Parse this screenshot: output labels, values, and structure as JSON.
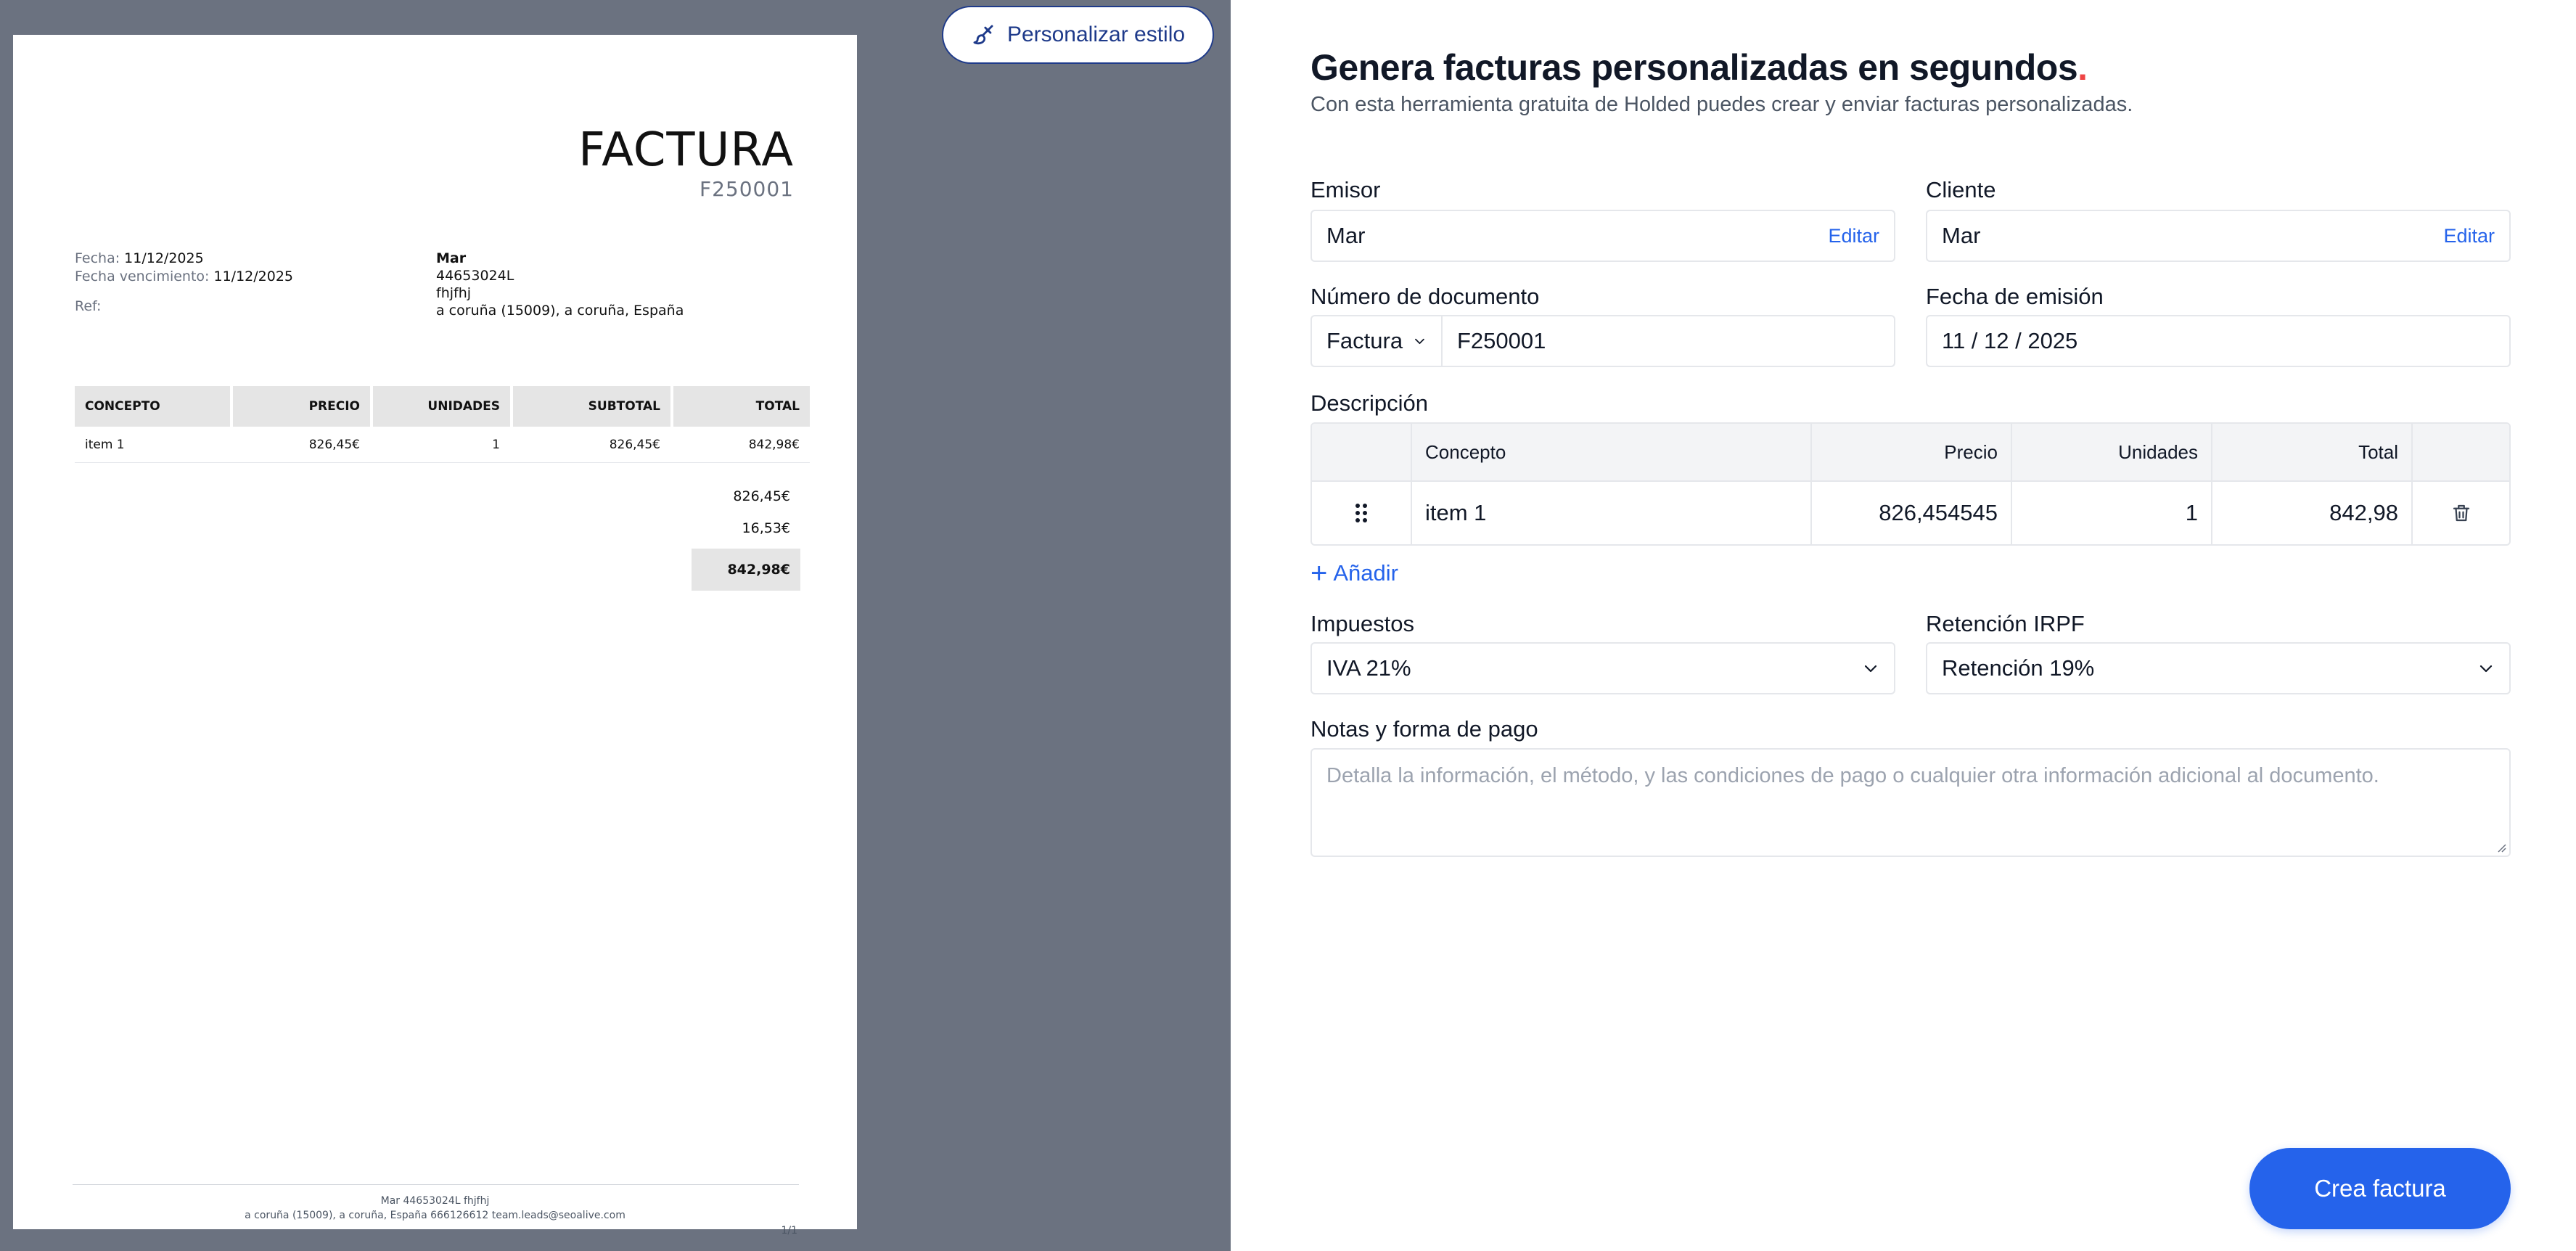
{
  "preview": {
    "style_button_label": "Personalizar estilo",
    "style_button_icon": "brush-icon",
    "document": {
      "title": "FACTURA",
      "number": "F250001",
      "date_label": "Fecha:",
      "date_value": "11/12/2025",
      "due_label": "Fecha vencimiento:",
      "due_value": "11/12/2025",
      "ref_label": "Ref:",
      "client": {
        "name": "Mar",
        "tax_id": "44653024L",
        "line": "fhjfhj",
        "address": "a coruña (15009), a coruña, España"
      },
      "table_headers": [
        "CONCEPTO",
        "PRECIO",
        "UNIDADES",
        "SUBTOTAL",
        "TOTAL"
      ],
      "rows": [
        [
          "item 1",
          "826,45€",
          "1",
          "826,45€",
          "842,98€"
        ]
      ],
      "subtotal": "826,45€",
      "tax_amount": "16,53€",
      "total": "842,98€",
      "footer_line1": "Mar 44653024L fhjfhj",
      "footer_line2": "a coruña (15009), a coruña, España 666126612 team.leads@seoalive.com",
      "page_indicator": "1/1"
    }
  },
  "form": {
    "heading": "Genera facturas personalizadas en segundos",
    "heading_dot": ".",
    "subheading": "Con esta herramienta gratuita de Holded puedes crear y enviar facturas personalizadas.",
    "issuer_label": "Emisor",
    "issuer_value": "Mar",
    "issuer_edit": "Editar",
    "client_label": "Cliente",
    "client_value": "Mar",
    "client_edit": "Editar",
    "doc_number_label": "Número de documento",
    "doc_type": "Factura",
    "doc_number": "F250001",
    "issue_date_label": "Fecha de emisión",
    "issue_date": "11 / 12 / 2025",
    "description_label": "Descripción",
    "lines_headers": {
      "concept": "Concepto",
      "price": "Precio",
      "units": "Unidades",
      "total": "Total"
    },
    "lines": [
      {
        "concept": "item 1",
        "price": "826,454545",
        "units": "1",
        "total": "842,98"
      }
    ],
    "add_label": "Añadir",
    "taxes_label": "Impuestos",
    "taxes_value": "IVA 21%",
    "irpf_label": "Retención IRPF",
    "irpf_value": "Retención 19%",
    "notes_label": "Notas y forma de pago",
    "notes_placeholder": "Detalla la información, el método, y las condiciones de pago o cualquier otra información adicional al documento.",
    "create_button": "Crea factura"
  },
  "colors": {
    "preview_background": "#6b7280",
    "accent": "#2563eb",
    "brand_dark": "#1e3a8a",
    "heading_dot": "#ef4444"
  }
}
